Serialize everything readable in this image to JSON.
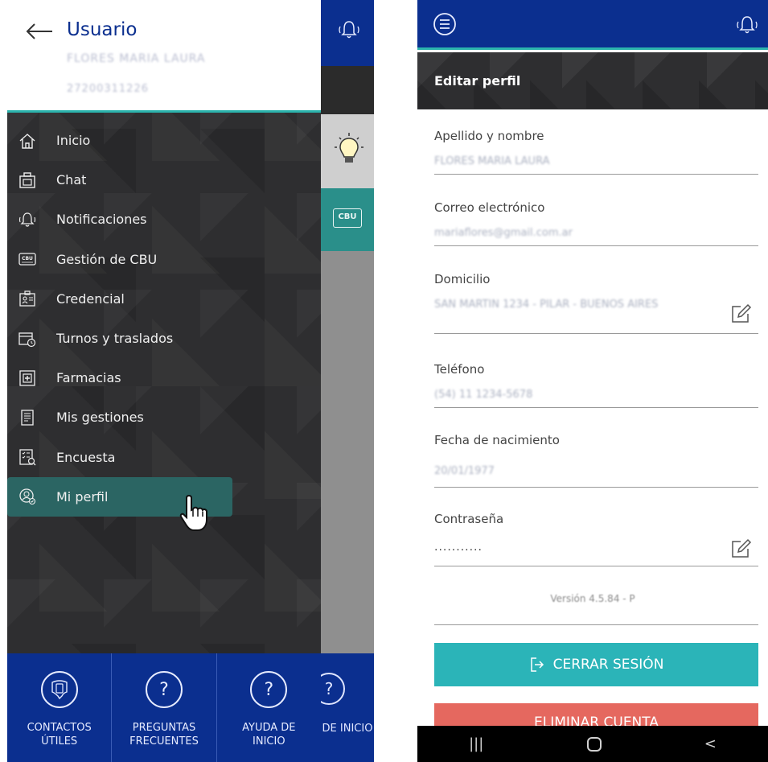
{
  "left": {
    "drawer": {
      "title": "Usuario",
      "user_name": "FLORES MARIA LAURA",
      "user_id": "27200311226",
      "menu": [
        {
          "label": "Inicio",
          "icon": "home-icon"
        },
        {
          "label": "Chat",
          "icon": "chat-icon"
        },
        {
          "label": "Notificaciones",
          "icon": "bell-icon"
        },
        {
          "label": "Gestión de CBU",
          "icon": "cbu-icon"
        },
        {
          "label": "Credencial",
          "icon": "credential-icon"
        },
        {
          "label": "Turnos y traslados",
          "icon": "calendar-icon"
        },
        {
          "label": "Farmacias",
          "icon": "pharmacy-icon"
        },
        {
          "label": "Mis gestiones",
          "icon": "document-list-icon"
        },
        {
          "label": "Encuesta",
          "icon": "survey-icon"
        },
        {
          "label": "Mi perfil",
          "icon": "profile-icon"
        }
      ],
      "active_item": "Mi perfil",
      "footer": [
        {
          "label_line1": "CONTACTOS",
          "label_line2": "ÚTILES",
          "icon": "phone-contact-icon"
        },
        {
          "label_line1": "PREGUNTAS",
          "label_line2": "FRECUENTES",
          "icon": "question-icon"
        },
        {
          "label_line1": "AYUDA DE",
          "label_line2": "INICIO",
          "icon": "question-icon"
        }
      ]
    },
    "background": {
      "cbu_badge": "CBU",
      "bottom_text": "DE INICIO",
      "bottom_circle": "?"
    }
  },
  "right": {
    "page_title": "Editar perfil",
    "fields": {
      "name": {
        "label": "Apellido y nombre",
        "value": "FLORES MARIA LAURA"
      },
      "email": {
        "label": "Correo electrónico",
        "value": "mariaflores@gmail.com.ar"
      },
      "address": {
        "label": "Domicilio",
        "value": "SAN MARTIN 1234 - PILAR - BUENOS AIRES"
      },
      "phone": {
        "label": "Teléfono",
        "value": "(54) 11 1234-5678"
      },
      "birthdate": {
        "label": "Fecha de nacimiento",
        "value": "20/01/1977"
      },
      "password": {
        "label": "Contraseña",
        "value": "..........."
      }
    },
    "version": "Versión 4.5.84 - P",
    "logout_label": "CERRAR SESIÓN",
    "delete_label": "ELIMINAR CUENTA",
    "system_nav": {
      "recents": "|||",
      "back": "<"
    }
  }
}
